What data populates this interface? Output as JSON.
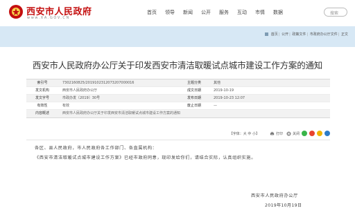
{
  "header": {
    "logo_title": "西安市人民政府",
    "logo_url": "www.XA.GOV.CN",
    "nav": [
      "首页",
      "领导",
      "新闻",
      "公开",
      "服务",
      "互动",
      "市情",
      "数据"
    ],
    "search_label": "搜索"
  },
  "breadcrumb": [
    "首页",
    "公开",
    "政策文件",
    "市政府办公厅文件",
    "正文"
  ],
  "document": {
    "title": "西安市人民政府办公厅关于印发西安市清洁取暖试点城市建设工作方案的通知"
  },
  "meta": {
    "rows": [
      {
        "l1": "索引号",
        "v1": "7302160825/2019102312073207000016",
        "l2": "主题分类",
        "v2": "其他"
      },
      {
        "l1": "发文机构",
        "v1": "西安市人民政府办公厅",
        "l2": "成文日期",
        "v2": "2019-10-19"
      },
      {
        "l1": "发文字号",
        "v1": "市政办发〔2019〕30号",
        "l2": "发布日期",
        "v2": "2019-10-23 12:07"
      },
      {
        "l1": "有效性",
        "v1": "有效",
        "l2": "废止日期",
        "v2": "—"
      },
      {
        "l1": "内容概述",
        "v1": "西安市人民政府办公厅关于印发西安市清洁取暖试点城市建设工作方案的通知"
      }
    ]
  },
  "toolbar": {
    "font_size_label": "【字体：大 中 小】",
    "print_label": "打印",
    "close_label": "关闭",
    "share_colors": [
      "#39b54a",
      "#e8432e",
      "#f0b400",
      "#2d7cc8"
    ]
  },
  "body": {
    "salutation": "各区、县人民政府，市人民政府各工作部门、各直属机构：",
    "paragraph": "《西安市清洁取暖试点城市建设工作方案》已经市政府同意，现印发给你们，请结合实际，认真组织实施。",
    "sign_org": "西安市人民政府办公厅",
    "sign_date": "2019年10月19日"
  }
}
